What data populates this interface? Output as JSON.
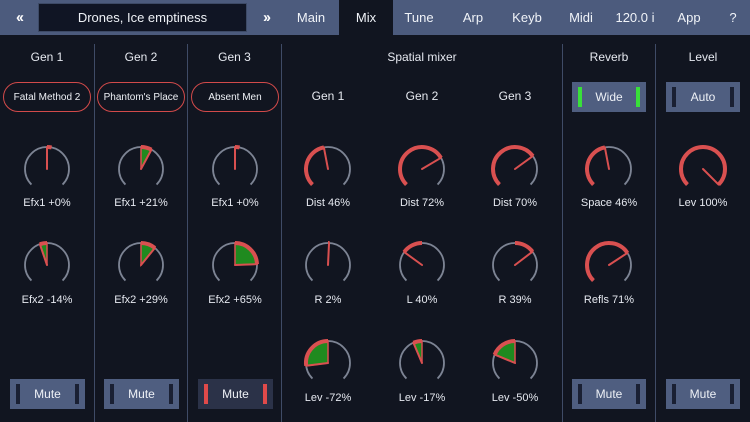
{
  "topbar": {
    "prev_label": "‹‹",
    "next_label": "››",
    "preset_name": "Drones, Ice emptiness",
    "tabs": [
      {
        "label": "Main",
        "active": false
      },
      {
        "label": "Mix",
        "active": true
      },
      {
        "label": "Tune",
        "active": false
      },
      {
        "label": "Arp",
        "active": false
      },
      {
        "label": "Keyb",
        "active": false
      },
      {
        "label": "Midi",
        "active": false
      },
      {
        "label": "120.0 i",
        "active": false
      },
      {
        "label": "App",
        "active": false
      },
      {
        "label": "?",
        "active": false
      }
    ]
  },
  "gens": [
    {
      "title": "Gen 1",
      "patch": "Fatal Method 2",
      "efx1": "Efx1 +0%",
      "efx2": "Efx2 -14%",
      "mute": "Mute",
      "muted": false,
      "efx1_val": 0.0,
      "efx2_val": -0.14
    },
    {
      "title": "Gen 2",
      "patch": "Phantom's Place",
      "efx1": "Efx1 +21%",
      "efx2": "Efx2 +29%",
      "mute": "Mute",
      "muted": false,
      "efx1_val": 0.21,
      "efx2_val": 0.29
    },
    {
      "title": "Gen 3",
      "patch": "Absent Men",
      "efx1": "Efx1 +0%",
      "efx2": "Efx2 +65%",
      "mute": "Mute",
      "muted": true,
      "efx1_val": 0.0,
      "efx2_val": 0.65
    }
  ],
  "spatial": {
    "title": "Spatial mixer",
    "cols": [
      {
        "title": "Gen 1",
        "dist": "Dist 46%",
        "pan": "R 2%",
        "lev": "Lev -72%",
        "dist_val": 0.46,
        "pan_val": 0.02,
        "lev_val": -0.72
      },
      {
        "title": "Gen 2",
        "dist": "Dist 72%",
        "pan": "L 40%",
        "lev": "Lev -17%",
        "dist_val": 0.72,
        "pan_val": -0.4,
        "lev_val": -0.17
      },
      {
        "title": "Gen 3",
        "dist": "Dist 70%",
        "pan": "R 39%",
        "lev": "Lev -50%",
        "dist_val": 0.7,
        "pan_val": 0.39,
        "lev_val": -0.5
      }
    ]
  },
  "reverb": {
    "title": "Reverb",
    "mode": "Wide",
    "space": "Space 46%",
    "refls": "Refls 71%",
    "mute": "Mute",
    "space_val": 0.46,
    "refls_val": 0.71
  },
  "level": {
    "title": "Level",
    "mode": "Auto",
    "lev": "Lev 100%",
    "mute": "Mute",
    "lev_val": 1.0
  },
  "colors": {
    "accent_red": "#d95050",
    "fill_green": "#1f8a1f",
    "track_gray": "#7d8494",
    "button_blue": "#4f5e80"
  }
}
